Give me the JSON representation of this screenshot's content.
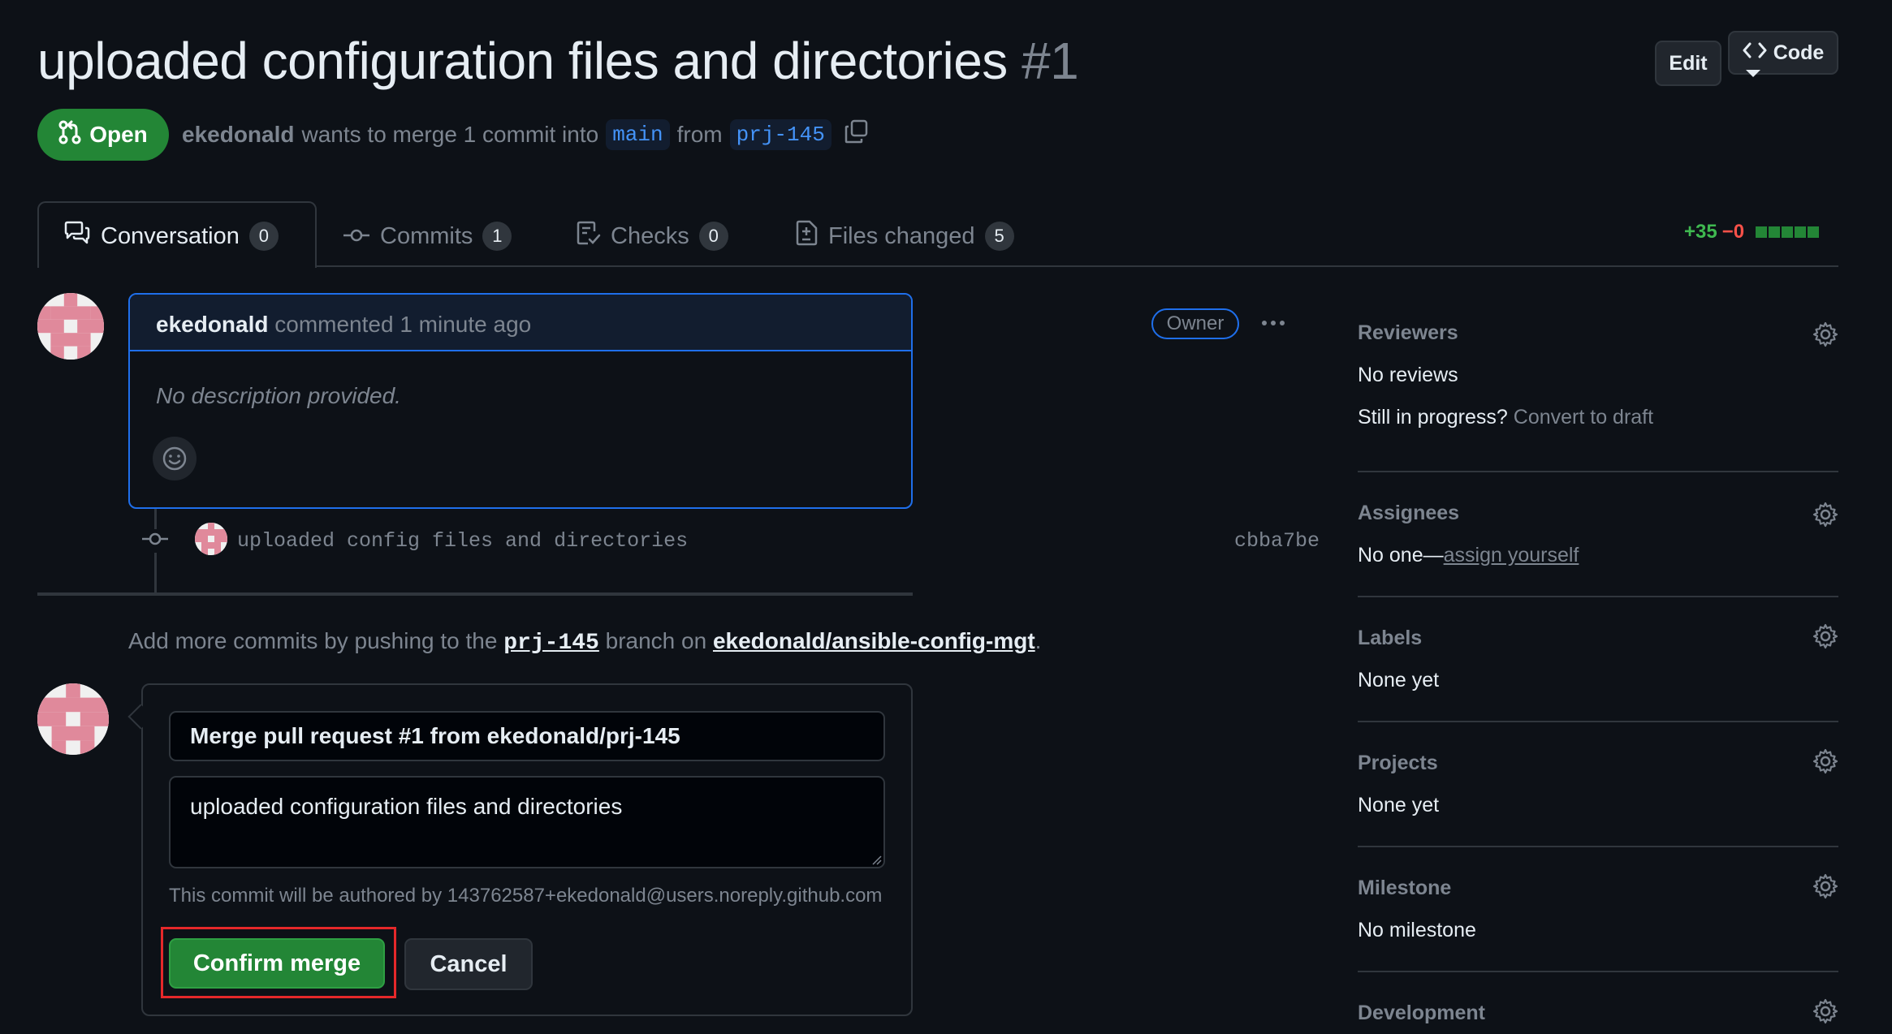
{
  "header": {
    "title": "uploaded configuration files and directories",
    "number": "#1",
    "edit_label": "Edit",
    "code_label": "Code"
  },
  "status": {
    "state": "Open",
    "author": "ekedonald",
    "text_mid": "wants to merge 1 commit into",
    "base_branch": "main",
    "text_from": "from",
    "head_branch": "prj-145"
  },
  "tabs": [
    {
      "label": "Conversation",
      "count": "0"
    },
    {
      "label": "Commits",
      "count": "1"
    },
    {
      "label": "Checks",
      "count": "0"
    },
    {
      "label": "Files changed",
      "count": "5"
    }
  ],
  "diffstat": {
    "additions": "+35",
    "deletions": "−0"
  },
  "comment": {
    "author": "ekedonald",
    "action": "commented 1 minute ago",
    "role": "Owner",
    "body": "No description provided."
  },
  "commit": {
    "message": "uploaded config files and directories",
    "sha": "cbba7be"
  },
  "push_hint": {
    "prefix": "Add more commits by pushing to the",
    "branch": "prj-145",
    "middle": "branch on",
    "repo": "ekedonald/ansible-config-mgt",
    "suffix": "."
  },
  "merge": {
    "title_value": "Merge pull request #1 from ekedonald/prj-145",
    "body_value": "uploaded configuration files and directories",
    "authored_note": "This commit will be authored by 143762587+ekedonald@users.noreply.github.com",
    "confirm_label": "Confirm merge",
    "cancel_label": "Cancel"
  },
  "sidebar": {
    "reviewers": {
      "title": "Reviewers",
      "value": "No reviews",
      "progress_label": "Still in progress?",
      "progress_link": "Convert to draft"
    },
    "assignees": {
      "title": "Assignees",
      "value_prefix": "No one—",
      "link": "assign yourself"
    },
    "labels": {
      "title": "Labels",
      "value": "None yet"
    },
    "projects": {
      "title": "Projects",
      "value": "None yet"
    },
    "milestone": {
      "title": "Milestone",
      "value": "No milestone"
    },
    "development": {
      "title": "Development"
    }
  },
  "colors": {
    "background": "#0d1117",
    "open_green": "#238636",
    "link_blue": "#4493f8",
    "highlight_red": "#e5282a"
  },
  "icons": [
    "git-pull-request-icon",
    "copy-icon",
    "conversation-icon",
    "commit-icon",
    "checklist-icon",
    "file-diff-icon",
    "kebab-icon",
    "smiley-icon",
    "gear-icon",
    "code-icon"
  ]
}
